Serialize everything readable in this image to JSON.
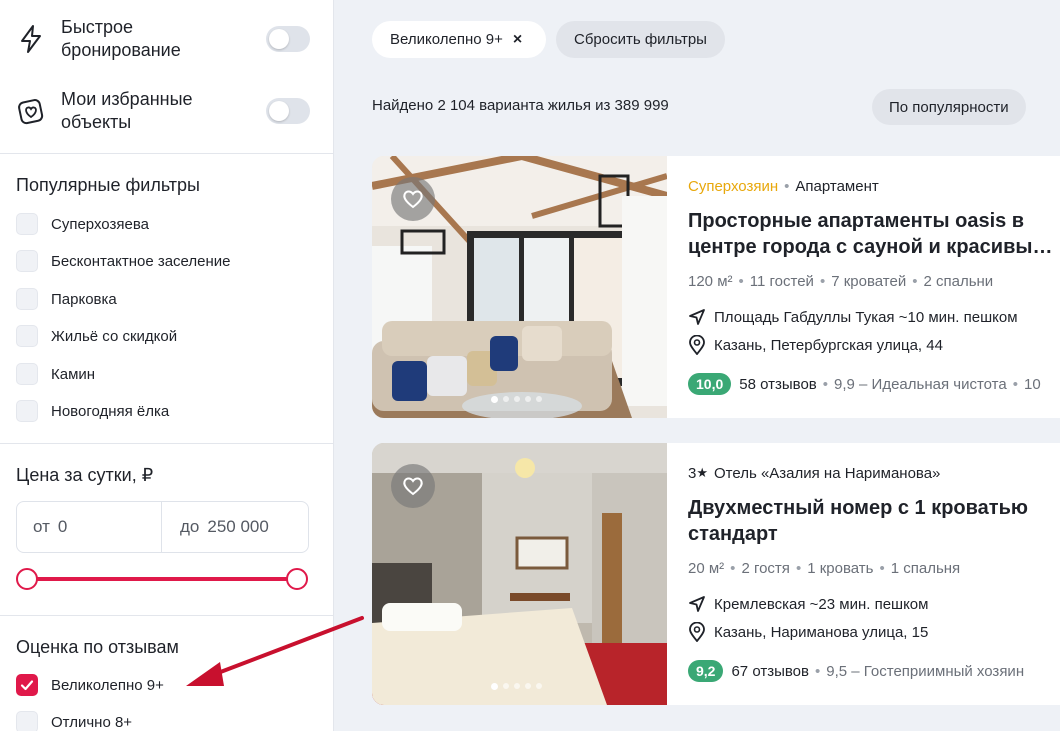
{
  "sidebar": {
    "quick_booking": "Быстрое бронирование",
    "favorites": "Мои избранные объекты",
    "popular_title": "Популярные фильтры",
    "popular_filters": [
      {
        "label": "Суперхозяева",
        "checked": false
      },
      {
        "label": "Бесконтактное заселение",
        "checked": false
      },
      {
        "label": "Парковка",
        "checked": false
      },
      {
        "label": "Жильё со скидкой",
        "checked": false
      },
      {
        "label": "Камин",
        "checked": false
      },
      {
        "label": "Новогодняя ёлка",
        "checked": false
      }
    ],
    "price_title": "Цена за сутки, ₽",
    "price_from_prefix": "от",
    "price_from": "0",
    "price_to_prefix": "до",
    "price_to": "250 000",
    "rating_title": "Оценка по отзывам",
    "rating_filters": [
      {
        "label": "Великолепно 9+",
        "checked": true
      },
      {
        "label": "Отлично 8+",
        "checked": false
      }
    ]
  },
  "main": {
    "active_chip": "Великолепно 9+",
    "active_chip_close": "×",
    "reset_chip": "Сбросить фильтры",
    "found_text": "Найдено 2 104 варианта жилья из 389 999",
    "sort_label": "По популярности",
    "listings": [
      {
        "badge": "Суперхозяин",
        "type": "Апартамент",
        "title": "Просторные апартаменты oasis в центре города с сауной и красивы…",
        "specs": [
          "120 м²",
          "11 гостей",
          "7 кроватей",
          "2 спальни"
        ],
        "landmark": "Площадь Габдуллы Тукая ~10 мин. пешком",
        "address": "Казань, Петербургская улица, 44",
        "score": "10,0",
        "reviews": "58 отзывов",
        "extra": "9,9 – Идеальная чистота",
        "extra2": "10"
      },
      {
        "stars": "3",
        "type": "Отель «Азалия на Нариманова»",
        "title": "Двухместный номер с 1 кроватью стандарт",
        "specs": [
          "20 м²",
          "2 гостя",
          "1 кровать",
          "1 спальня"
        ],
        "landmark": "Кремлевская ~23 мин. пешком",
        "address": "Казань, Нариманова улица, 15",
        "score": "9,2",
        "reviews": "67 отзывов",
        "extra": "9,5 – Гостеприимный хозяин"
      }
    ]
  },
  "colors": {
    "accent": "#e0194a",
    "score": "#3aa875",
    "superhost": "#e8a80c",
    "arrow": "#c8102e"
  },
  "icons": [
    "lightning-icon",
    "heart-badge-icon",
    "heart-icon",
    "navigation-arrow-icon",
    "map-pin-icon",
    "check-icon",
    "star-icon"
  ]
}
